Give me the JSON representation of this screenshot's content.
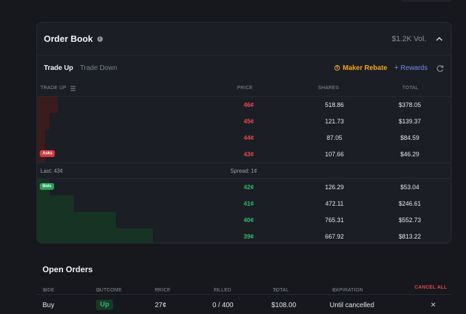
{
  "order_book": {
    "title": "Order Book",
    "volume": "$1.2K Vol.",
    "tabs": [
      "Trade Up",
      "Trade Down"
    ],
    "maker_rebate": "Maker Rebate",
    "rewards": "Rewards",
    "columns": {
      "side": "TRADE UP",
      "price": "PRICE",
      "shares": "SHARES",
      "total": "TOTAL"
    },
    "asks_label": "Asks",
    "bids_label": "Bids",
    "asks": [
      {
        "price": "46¢",
        "shares": "518.86",
        "total": "$378.05",
        "depth": 0.05
      },
      {
        "price": "45¢",
        "shares": "121.73",
        "total": "$139.37",
        "depth": 0.03
      },
      {
        "price": "44¢",
        "shares": "87.05",
        "total": "$84.59",
        "depth": 0.02
      },
      {
        "price": "43¢",
        "shares": "107.66",
        "total": "$46.29",
        "depth": 0.02
      }
    ],
    "last": "Last: 43¢",
    "spread": "Spread: 1¢",
    "bids": [
      {
        "price": "42¢",
        "shares": "126.29",
        "total": "$53.04",
        "depth": 0.03
      },
      {
        "price": "41¢",
        "shares": "472.11",
        "total": "$246.61",
        "depth": 0.09
      },
      {
        "price": "40¢",
        "shares": "765.31",
        "total": "$552.73",
        "depth": 0.19
      },
      {
        "price": "39¢",
        "shares": "667.92",
        "total": "$813.22",
        "depth": 0.28
      }
    ]
  },
  "open_orders": {
    "title": "Open Orders",
    "columns": {
      "side": "SIDE",
      "outcome": "OUTCOME",
      "price": "PRICE",
      "filled": "FILLED",
      "total": "TOTAL",
      "expiration": "EXPIRATION",
      "cancel_all": "CANCEL ALL"
    },
    "rows": [
      {
        "side": "Buy",
        "outcome": "Up",
        "price": "27¢",
        "filled": "0 / 400",
        "total": "$108.00",
        "expiration": "Until cancelled"
      }
    ]
  },
  "colors": {
    "ask": "#e5484d",
    "bid": "#30b86a",
    "maker": "#f5a623",
    "rewards": "#7b8cf0"
  },
  "icons": {
    "info": "info-icon",
    "collapse": "chevron-up-icon",
    "refresh": "refresh-icon",
    "coin": "coin-icon",
    "close": "close-icon",
    "sort": "sort-icon"
  }
}
